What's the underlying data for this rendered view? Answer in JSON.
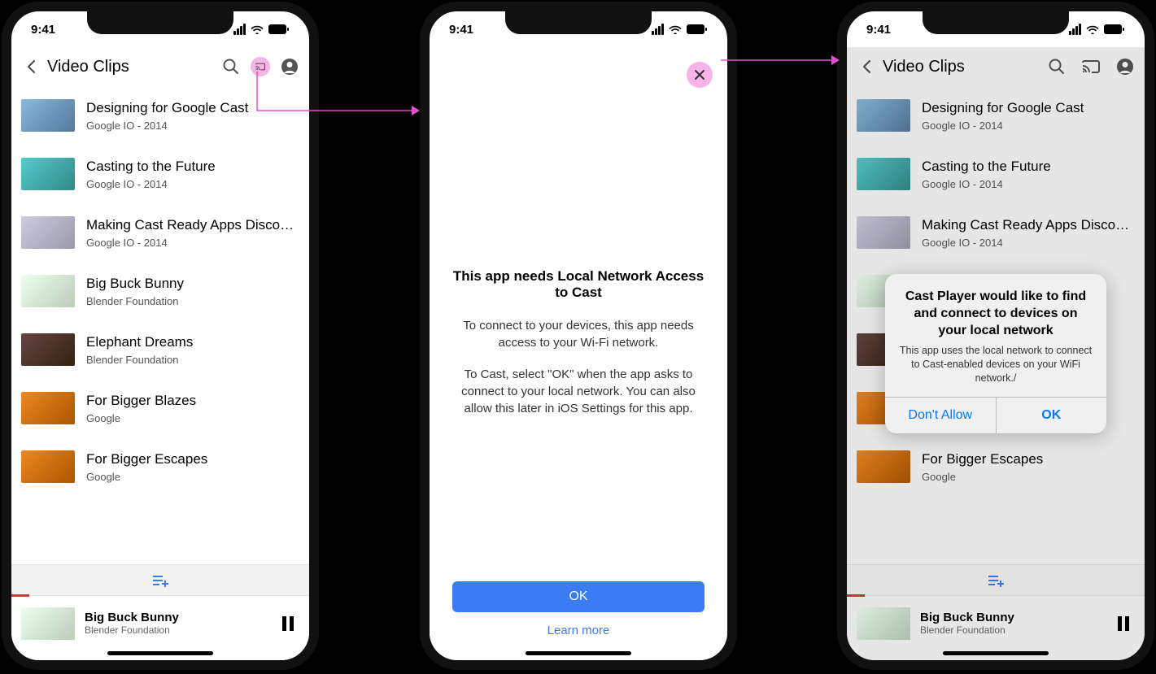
{
  "status": {
    "time": "9:41"
  },
  "header": {
    "title": "Video Clips"
  },
  "videos": [
    {
      "title": "Designing for Google Cast",
      "subtitle": "Google IO - 2014"
    },
    {
      "title": "Casting to the Future",
      "subtitle": "Google IO - 2014"
    },
    {
      "title": "Making Cast Ready Apps Discover...",
      "subtitle": "Google IO - 2014"
    },
    {
      "title": "Big Buck Bunny",
      "subtitle": "Blender Foundation"
    },
    {
      "title": "Elephant Dreams",
      "subtitle": "Blender Foundation"
    },
    {
      "title": "For Bigger Blazes",
      "subtitle": "Google"
    },
    {
      "title": "For Bigger Escapes",
      "subtitle": "Google"
    }
  ],
  "now_playing": {
    "title": "Big Buck Bunny",
    "subtitle": "Blender Foundation"
  },
  "modal": {
    "heading": "This app needs Local Network Access to Cast",
    "para1": "To connect to your devices, this app needs access to your Wi-Fi network.",
    "para2": "To Cast, select \"OK\" when the app asks to connect to your local network. You can also allow this later in iOS Settings for this app.",
    "ok": "OK",
    "learn": "Learn more"
  },
  "alert": {
    "title": "Cast Player would like to find and connect to devices on your local network",
    "message": "This app uses the local network to connect to Cast-enabled devices on your WiFi network./",
    "deny": "Don't Allow",
    "allow": "OK"
  }
}
